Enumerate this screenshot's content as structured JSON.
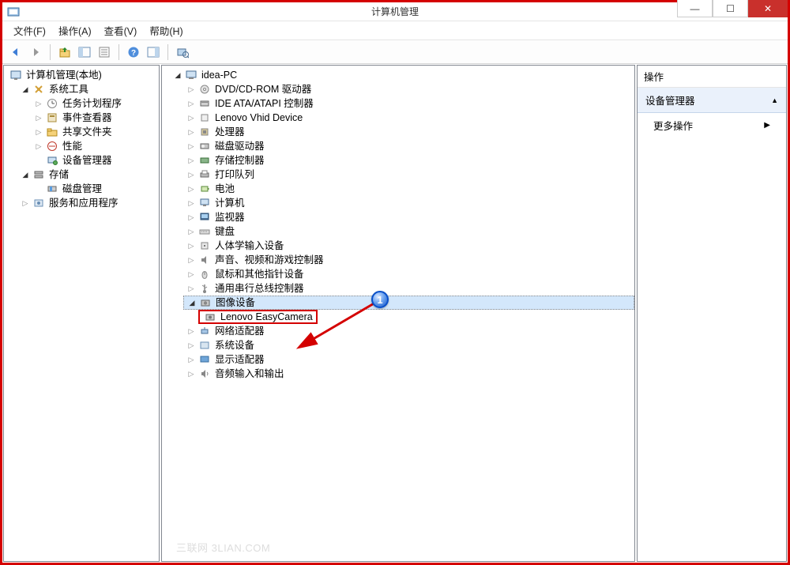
{
  "window": {
    "title": "计算机管理",
    "minimize": "—",
    "maximize": "☐",
    "close": "✕"
  },
  "menubar": {
    "file": "文件(F)",
    "action": "操作(A)",
    "view": "查看(V)",
    "help": "帮助(H)"
  },
  "left_tree": {
    "root": "计算机管理(本地)",
    "system_tools": "系统工具",
    "task_scheduler": "任务计划程序",
    "event_viewer": "事件查看器",
    "shared_folders": "共享文件夹",
    "performance": "性能",
    "device_manager": "设备管理器",
    "storage": "存储",
    "disk_management": "磁盘管理",
    "services_and_apps": "服务和应用程序"
  },
  "device_tree": {
    "root": "idea-PC",
    "dvd": "DVD/CD-ROM 驱动器",
    "ide": "IDE ATA/ATAPI 控制器",
    "lenovo_vhid": "Lenovo Vhid Device",
    "processors": "处理器",
    "disk_drives": "磁盘驱动器",
    "storage_controllers": "存储控制器",
    "print_queues": "打印队列",
    "batteries": "电池",
    "computer": "计算机",
    "monitors": "监视器",
    "keyboards": "键盘",
    "hid": "人体学输入设备",
    "sound": "声音、视频和游戏控制器",
    "mouse": "鼠标和其他指针设备",
    "usb": "通用串行总线控制器",
    "imaging": "图像设备",
    "easycamera": "Lenovo EasyCamera",
    "network": "网络适配器",
    "system_devices": "系统设备",
    "display": "显示适配器",
    "audio_io": "音频输入和输出"
  },
  "right_pane": {
    "header": "操作",
    "section": "设备管理器",
    "more_actions": "更多操作"
  },
  "watermark": "三联网 3LIAN.COM",
  "annotation": {
    "marker": "1"
  }
}
